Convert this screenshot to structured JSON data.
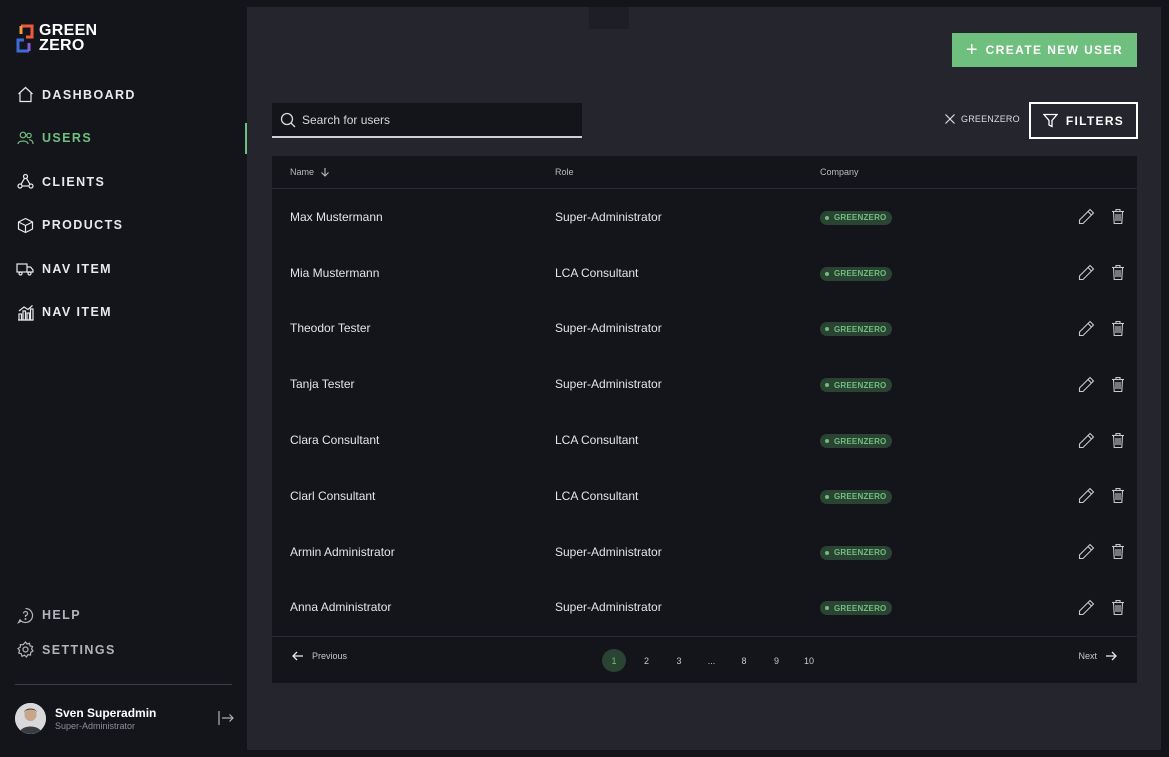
{
  "brand": {
    "line1": "GREEN",
    "line2": "ZERO"
  },
  "nav": [
    {
      "label": "DASHBOARD",
      "icon": "home-icon",
      "active": false
    },
    {
      "label": "USERS",
      "icon": "users-icon",
      "active": true
    },
    {
      "label": "CLIENTS",
      "icon": "clients-icon",
      "active": false
    },
    {
      "label": "PRODUCTS",
      "icon": "box-icon",
      "active": false
    },
    {
      "label": "NAV ITEM",
      "icon": "truck-icon",
      "active": false
    },
    {
      "label": "NAV ITEM",
      "icon": "chart-icon",
      "active": false
    }
  ],
  "bottom_nav": [
    {
      "label": "HELP",
      "icon": "help-icon"
    },
    {
      "label": "SETTINGS",
      "icon": "gear-icon"
    }
  ],
  "profile": {
    "name": "Sven Superadmin",
    "role": "Super-Administrator"
  },
  "toolbar": {
    "create_label": "CREATE NEW USER",
    "search_placeholder": "Search for users",
    "active_filter": "GREENZERO",
    "filters_label": "FILTERS"
  },
  "table": {
    "headers": {
      "name": "Name",
      "role": "Role",
      "company": "Company"
    },
    "rows": [
      {
        "name": "Max Mustermann",
        "role": "Super-Administrator",
        "company": "GREENZERO"
      },
      {
        "name": "Mia Mustermann",
        "role": "LCA Consultant",
        "company": "GREENZERO"
      },
      {
        "name": "Theodor Tester",
        "role": "Super-Administrator",
        "company": "GREENZERO"
      },
      {
        "name": "Tanja Tester",
        "role": "Super-Administrator",
        "company": "GREENZERO"
      },
      {
        "name": "Clara Consultant",
        "role": "LCA Consultant",
        "company": "GREENZERO"
      },
      {
        "name": "Clarl Consultant",
        "role": "LCA Consultant",
        "company": "GREENZERO"
      },
      {
        "name": "Armin Administrator",
        "role": "Super-Administrator",
        "company": "GREENZERO"
      },
      {
        "name": "Anna Administrator",
        "role": "Super-Administrator",
        "company": "GREENZERO"
      }
    ]
  },
  "pagination": {
    "prev_label": "Previous",
    "next_label": "Next",
    "pages": [
      "1",
      "2",
      "3",
      "...",
      "8",
      "9",
      "10"
    ],
    "current": "1"
  },
  "colors": {
    "accent": "#6fbf7e",
    "sidebar_bg": "#14151b",
    "panel_bg": "#24252d",
    "badge_bg": "#2b4332"
  }
}
